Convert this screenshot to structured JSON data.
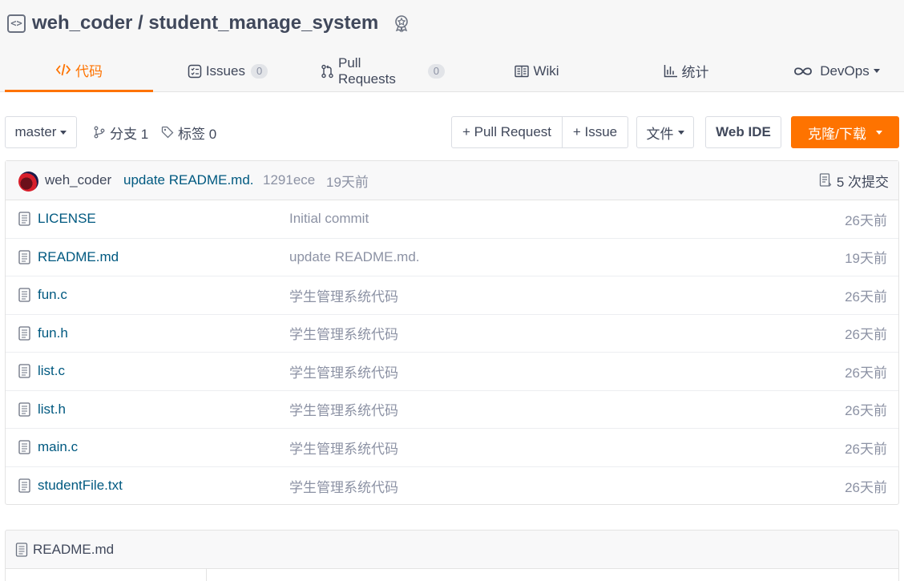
{
  "repo": {
    "owner": "weh_coder",
    "separator": " / ",
    "name": "student_manage_system"
  },
  "tabs": [
    {
      "label": "代码",
      "icon": "code-icon",
      "active": true
    },
    {
      "label": "Issues",
      "icon": "issues-icon",
      "count": "0"
    },
    {
      "label": "Pull Requests",
      "icon": "pull-request-icon",
      "count": "0"
    },
    {
      "label": "Wiki",
      "icon": "wiki-icon"
    },
    {
      "label": "统计",
      "icon": "stats-icon"
    },
    {
      "label": "DevOps",
      "icon": "devops-icon"
    }
  ],
  "toolbar": {
    "branch": "master",
    "branches_label": "分支 1",
    "tags_label": "标签 0",
    "pull_request": "+ Pull Request",
    "issue": "+ Issue",
    "file": "文件",
    "web_ide": "Web IDE",
    "clone": "克隆/下载"
  },
  "commit": {
    "author": "weh_coder",
    "message": "update README.md.",
    "sha": "1291ece",
    "time": "19天前",
    "count_label": "5 次提交"
  },
  "files": [
    {
      "name": "LICENSE",
      "message": "Initial commit",
      "time": "26天前"
    },
    {
      "name": "README.md",
      "message": "update README.md.",
      "time": "19天前"
    },
    {
      "name": "fun.c",
      "message": "学生管理系统代码",
      "time": "26天前"
    },
    {
      "name": "fun.h",
      "message": "学生管理系统代码",
      "time": "26天前"
    },
    {
      "name": "list.c",
      "message": "学生管理系统代码",
      "time": "26天前"
    },
    {
      "name": "list.h",
      "message": "学生管理系统代码",
      "time": "26天前"
    },
    {
      "name": "main.c",
      "message": "学生管理系统代码",
      "time": "26天前"
    },
    {
      "name": "studentFile.txt",
      "message": "学生管理系统代码",
      "time": "26天前"
    }
  ],
  "readme": {
    "title": "README.md"
  },
  "colors": {
    "accent": "#fe7300",
    "link": "#005980",
    "muted": "#8c92a4"
  }
}
